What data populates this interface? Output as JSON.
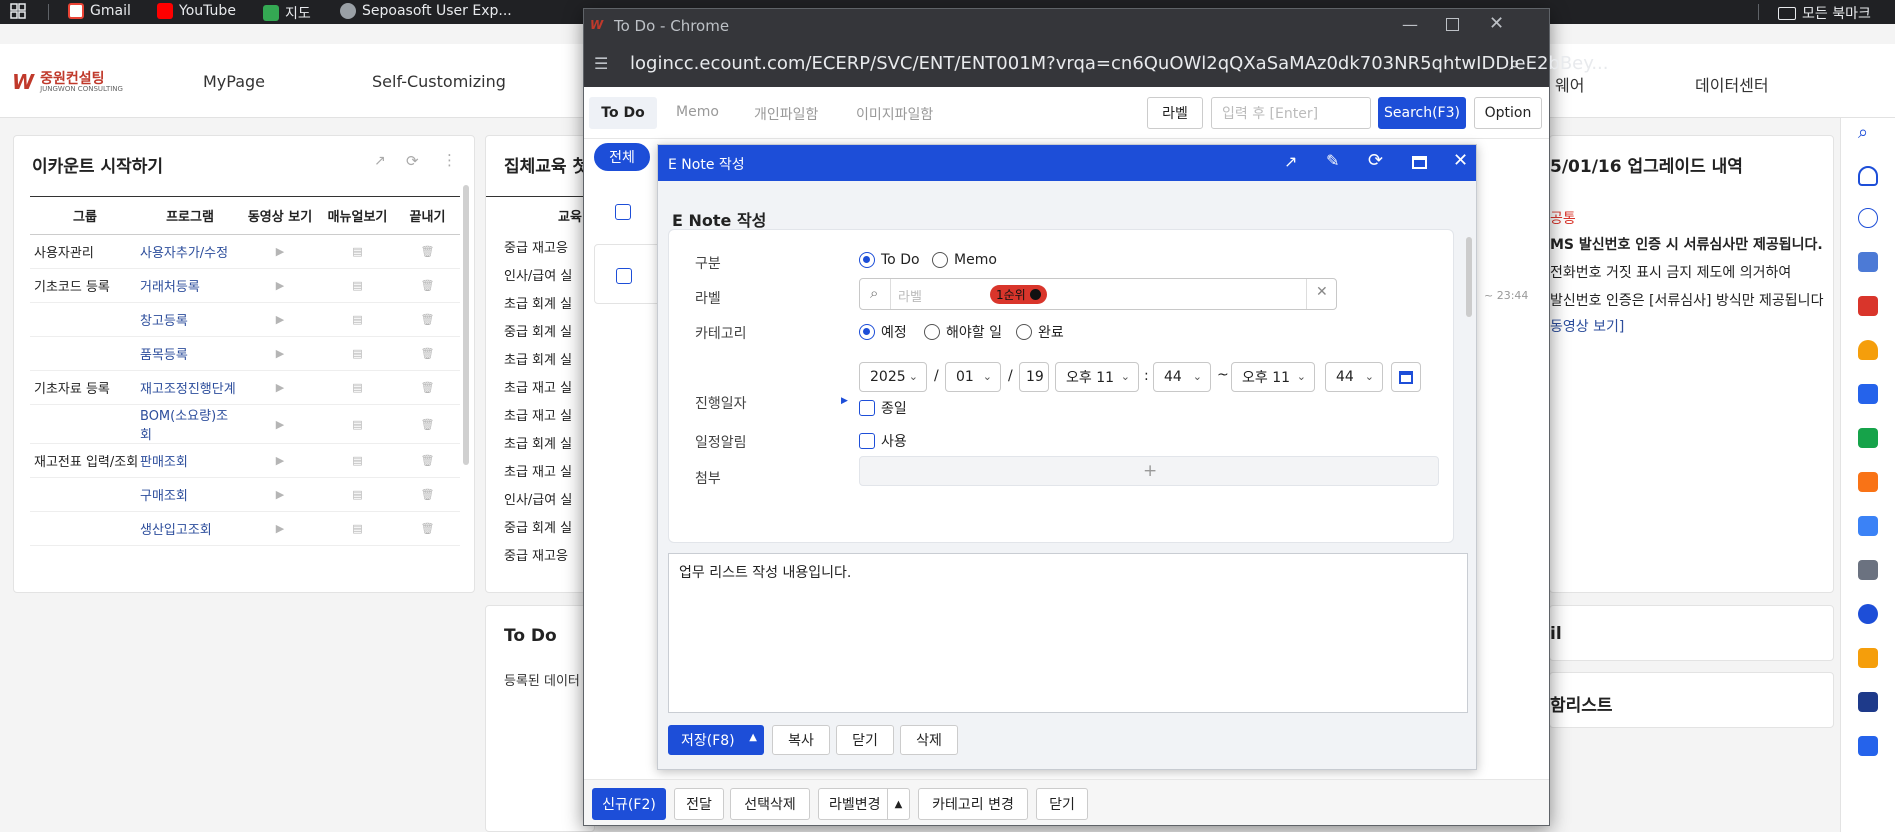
{
  "bookmarks": {
    "items": [
      {
        "label": "Gmail",
        "icon": "gmail-icon",
        "color": "#ea4335"
      },
      {
        "label": "YouTube",
        "icon": "youtube-icon",
        "color": "#ff0000"
      },
      {
        "label": "지도",
        "icon": "maps-icon",
        "color": "#34a853"
      },
      {
        "label": "Sepoasoft User Exp...",
        "icon": "globe-icon",
        "color": "#9aa0a6"
      }
    ],
    "all_bookmarks": "모든 북마크"
  },
  "app": {
    "logo_text": "중원컨설팅",
    "logo_sub": "JUNGWON CONSULTING",
    "nav": [
      "MyPage",
      "Self-Customizing",
      "웨어",
      "데이터센터"
    ]
  },
  "start_panel": {
    "title": "이카운트 시작하기",
    "headers": [
      "그룹",
      "프로그램",
      "동영상 보기",
      "매뉴얼보기",
      "끝내기"
    ],
    "rows": [
      {
        "group": "사용자관리",
        "program": "사용자추가/수정"
      },
      {
        "group": "기초코드 등록",
        "program": "거래처등록"
      },
      {
        "group": "",
        "program": "창고등록"
      },
      {
        "group": "",
        "program": "품목등록"
      },
      {
        "group": "기초자료 등록",
        "program": "재고조정진행단계"
      },
      {
        "group": "",
        "program": "BOM(소요량)조회"
      },
      {
        "group": "재고전표 입력/조회",
        "program": "판매조회"
      },
      {
        "group": "",
        "program": "구매조회"
      },
      {
        "group": "",
        "program": "생산입고조회"
      }
    ]
  },
  "edu_panel": {
    "title": "집체교육 첫",
    "col": "교육",
    "rows": [
      "중급 재고응",
      "인사/급여 실",
      "초급 회계 실",
      "중급 회계 실",
      "초급 회계 실",
      "초급 재고 실",
      "초급 재고 실",
      "초급 회계 실",
      "초급 재고 실",
      "인사/급여 실",
      "중급 회계 실",
      "중급 재고응"
    ]
  },
  "todo_panel": {
    "title": "To Do",
    "empty": "등록된 데이터"
  },
  "notice_panel": {
    "title": "5/01/16 업그레이드 내역",
    "tag": "공통",
    "lines": [
      "MS 발신번호 인증 시 서류심사만 제공됩니다.",
      "전화번호 거짓 표시 금지 제도에 의거하여",
      "발신번호 인증은 [서류심사] 방식만 제공됩니다",
      "동영상 보기]"
    ]
  },
  "right_panels": {
    "mail": "il",
    "list": "함리스트"
  },
  "popup": {
    "window_title": "To Do - Chrome",
    "url": "logincc.ecount.com/ECERP/SVC/ENT/ENT001M?vrqa=cn6QuOWl2qQXaSaMAz0dk703NR5qhtwIDDIeE2bBey...",
    "tabs": [
      "To Do",
      "Memo",
      "개인파일함",
      "이미지파일함"
    ],
    "label_button": "라벨",
    "search_placeholder": "입력 후 [Enter]",
    "search_button": "Search(F3)",
    "option_button": "Option",
    "filter_all": "전체",
    "row_time": "~ 23:44",
    "bottom": {
      "new": "신규(F2)",
      "forward": "전달",
      "delete_selected": "선택삭제",
      "label_change": "라벨변경",
      "category_change": "카테고리 변경",
      "close": "닫기"
    }
  },
  "modal": {
    "header_title": "E Note 작성",
    "title": "E Note 작성",
    "fields": {
      "type_label": "구분",
      "type_options": [
        "To Do",
        "Memo"
      ],
      "type_selected": "To Do",
      "label_label": "라벨",
      "label_placeholder": "라벨",
      "label_chip": "1순위",
      "category_label": "카테고리",
      "category_options": [
        "예정",
        "해야할 일",
        "완료"
      ],
      "category_selected": "예정",
      "date_label": "진행일자",
      "year": "2025",
      "month": "01",
      "day": "19",
      "ampm_start": "오후 11",
      "minute_start": "44",
      "tilde": "~",
      "ampm_end": "오후 11",
      "minute_end": "44",
      "allday": "종일",
      "alarm_label": "일정알림",
      "alarm_use": "사용",
      "attach_label": "첨부"
    },
    "content": "업무 리스트 작성 내용입니다.",
    "footer": {
      "save": "저장(F8)",
      "copy": "복사",
      "close": "닫기",
      "delete": "삭제"
    }
  },
  "colors": {
    "primary": "#1d4ed8",
    "chip": "#d9352b",
    "chip_text": "#111"
  }
}
